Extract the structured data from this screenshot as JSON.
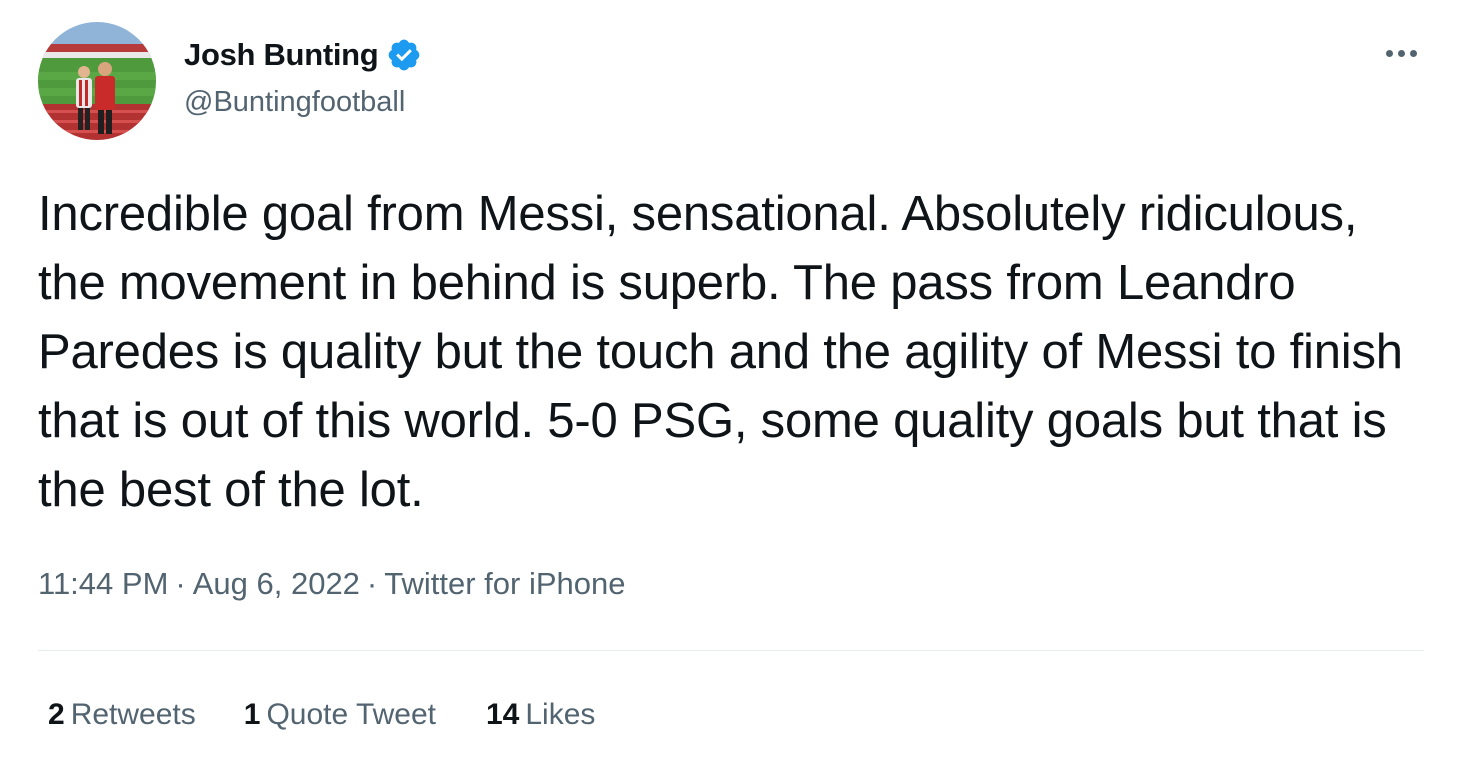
{
  "author": {
    "name": "Josh Bunting",
    "handle": "@Buntingfootball",
    "verified": true,
    "verified_color": "#1d9bf0",
    "avatar_icon": "avatar-photo-stadium"
  },
  "menu": {
    "icon": "more-horizontal-icon"
  },
  "tweet": {
    "text": "Incredible goal from Messi, sensational. Absolutely ridiculous, the movement in behind is superb. The pass from Leandro Paredes is quality but the touch and the agility of Messi to finish that is out of this world. 5-0 PSG, some quality goals but that is the best of the lot."
  },
  "meta": {
    "time": "11:44 PM",
    "separator": "·",
    "date": "Aug 6, 2022",
    "source": "Twitter for iPhone"
  },
  "stats": {
    "retweets": {
      "count": "2",
      "label": "Retweets"
    },
    "quotes": {
      "count": "1",
      "label": "Quote Tweet"
    },
    "likes": {
      "count": "14",
      "label": "Likes"
    }
  },
  "colors": {
    "text_primary": "#0f1419",
    "text_secondary": "#536471",
    "divider": "#e6ecf0"
  }
}
